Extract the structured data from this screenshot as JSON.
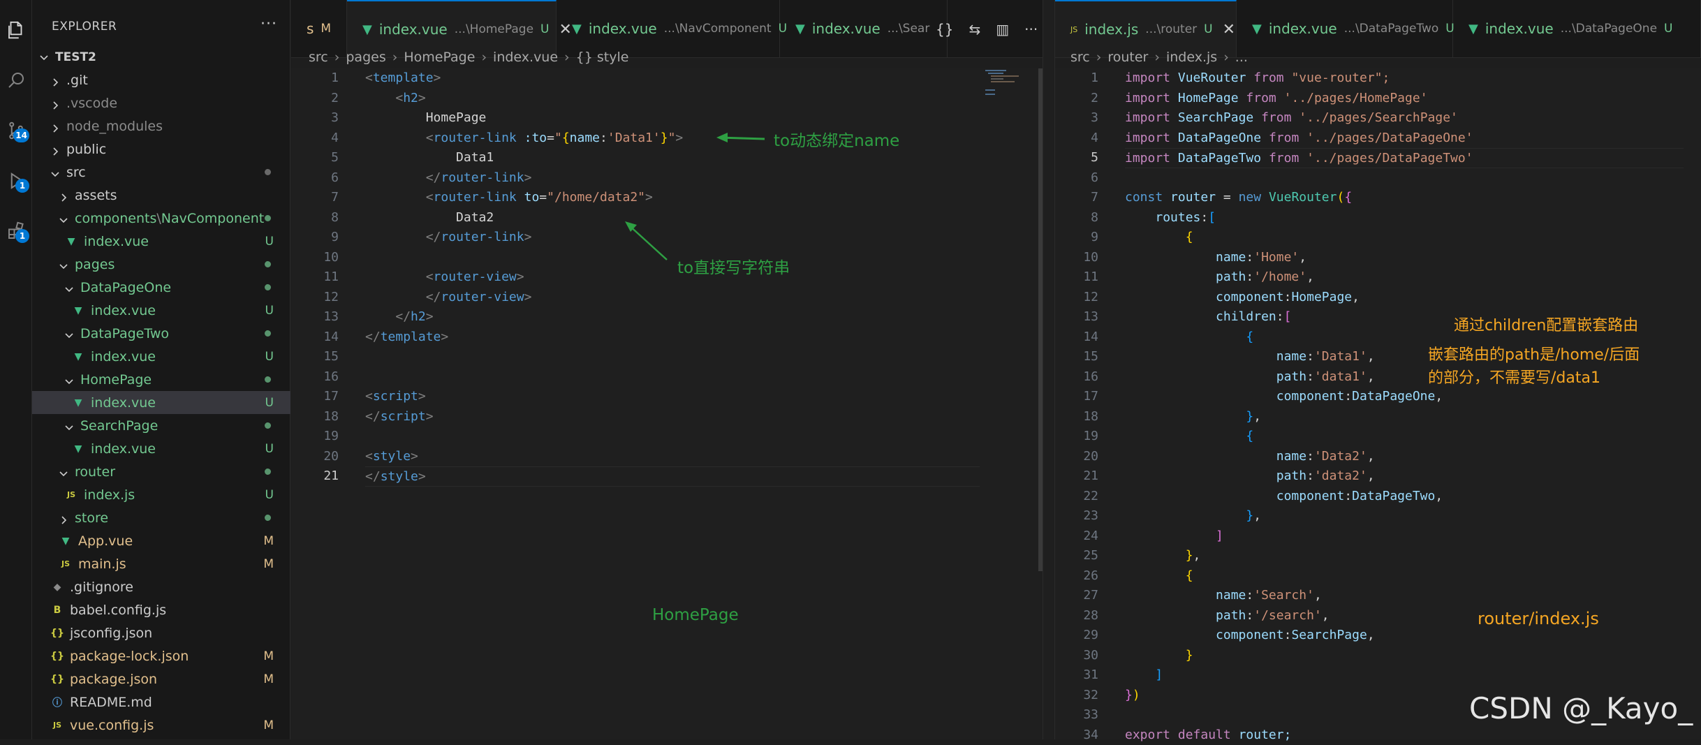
{
  "sidebar": {
    "title": "EXPLORER",
    "more": "···",
    "workspace": "TEST2",
    "items": [
      {
        "label": ".git",
        "type": "folder",
        "indent": 1,
        "expanded": false
      },
      {
        "label": ".vscode",
        "type": "folder",
        "indent": 1,
        "expanded": false,
        "dim": true
      },
      {
        "label": "node_modules",
        "type": "folder",
        "indent": 1,
        "expanded": false,
        "dim": true
      },
      {
        "label": "public",
        "type": "folder",
        "indent": 1,
        "expanded": false
      },
      {
        "label": "src",
        "type": "folder",
        "indent": 1,
        "expanded": true,
        "dot": "#8b8b8b"
      },
      {
        "label": "assets",
        "type": "folder",
        "indent": 2,
        "expanded": false
      },
      {
        "label": "components",
        "label2": "NavComponent",
        "type": "folder",
        "indent": 2,
        "expanded": true,
        "dot": "#73c991",
        "color": "green"
      },
      {
        "label": "index.vue",
        "type": "vue",
        "indent": 3,
        "status": "U",
        "color": "green"
      },
      {
        "label": "pages",
        "type": "folder",
        "indent": 2,
        "expanded": true,
        "dot": "#73c991",
        "color": "green"
      },
      {
        "label": "DataPageOne",
        "type": "folder",
        "indent": 3,
        "expanded": true,
        "dot": "#73c991",
        "color": "green"
      },
      {
        "label": "index.vue",
        "type": "vue",
        "indent": 4,
        "status": "U",
        "color": "green"
      },
      {
        "label": "DataPageTwo",
        "type": "folder",
        "indent": 3,
        "expanded": true,
        "dot": "#73c991",
        "color": "green"
      },
      {
        "label": "index.vue",
        "type": "vue",
        "indent": 4,
        "status": "U",
        "color": "green"
      },
      {
        "label": "HomePage",
        "type": "folder",
        "indent": 3,
        "expanded": true,
        "dot": "#73c991",
        "color": "green"
      },
      {
        "label": "index.vue",
        "type": "vue",
        "indent": 4,
        "status": "U",
        "color": "green",
        "selected": true
      },
      {
        "label": "SearchPage",
        "type": "folder",
        "indent": 3,
        "expanded": true,
        "dot": "#73c991",
        "color": "green"
      },
      {
        "label": "index.vue",
        "type": "vue",
        "indent": 4,
        "status": "U",
        "color": "green"
      },
      {
        "label": "router",
        "type": "folder",
        "indent": 2,
        "expanded": true,
        "dot": "#73c991",
        "color": "green"
      },
      {
        "label": "index.js",
        "type": "js",
        "indent": 3,
        "status": "U",
        "color": "green"
      },
      {
        "label": "store",
        "type": "folder",
        "indent": 2,
        "expanded": false,
        "dot": "#73c991",
        "color": "green"
      },
      {
        "label": "App.vue",
        "type": "vue",
        "indent": 2,
        "status": "M",
        "color": "yellow"
      },
      {
        "label": "main.js",
        "type": "js",
        "indent": 2,
        "status": "M",
        "color": "yellow"
      },
      {
        "label": ".gitignore",
        "type": "git",
        "indent": 1
      },
      {
        "label": "babel.config.js",
        "type": "babel",
        "indent": 1
      },
      {
        "label": "jsconfig.json",
        "type": "json",
        "indent": 1
      },
      {
        "label": "package-lock.json",
        "type": "json",
        "indent": 1,
        "status": "M",
        "color": "yellow"
      },
      {
        "label": "package.json",
        "type": "json",
        "indent": 1,
        "status": "M",
        "color": "yellow"
      },
      {
        "label": "README.md",
        "type": "info",
        "indent": 1
      },
      {
        "label": "vue.config.js",
        "type": "js",
        "indent": 1,
        "status": "M",
        "color": "yellow"
      }
    ]
  },
  "activity": {
    "scm_badge": "14",
    "run_badge": "1",
    "ext_badge": "1"
  },
  "left_editor": {
    "tabs": [
      {
        "label": "s",
        "desc": "",
        "status": "M",
        "partial": true
      },
      {
        "label": "index.vue",
        "desc": "...\\HomePage",
        "status": "U",
        "active": true,
        "close": "✕"
      },
      {
        "label": "index.vue",
        "desc": "...\\NavComponent",
        "status": "U"
      },
      {
        "label": "index.vue",
        "desc": "...\\Sear",
        "status": ""
      }
    ],
    "actions": [
      "{}",
      "⇆",
      "▥",
      "···"
    ],
    "breadcrumb": [
      "src",
      "pages",
      "HomePage",
      "index.vue",
      "{} style"
    ],
    "lines": [
      "1",
      "2",
      "3",
      "4",
      "5",
      "6",
      "7",
      "8",
      "9",
      "10",
      "11",
      "12",
      "13",
      "14",
      "15",
      "16",
      "17",
      "18",
      "19",
      "20",
      "21"
    ],
    "current_line": "21",
    "code": {
      "l1": "template",
      "l2": "h2",
      "l3": "HomePage",
      "l4_tag": "router-link",
      "l4_attr": ":to",
      "l4_str1": "\"",
      "l4_key": "name",
      "l4_val": "'Data1'",
      "l5": "Data1",
      "l6": "router-link",
      "l7_tag": "router-link",
      "l7_attr": "to",
      "l7_val": "\"/home/data2\"",
      "l8": "Data2",
      "l9": "router-link",
      "l11": "router-view",
      "l12": "router-view",
      "l13": "h2",
      "l14": "template",
      "l17": "script",
      "l18": "script",
      "l20": "style",
      "l21": "style"
    },
    "annotations": {
      "a1": "to动态绑定name",
      "a2": "to直接写字符串",
      "a3": "HomePage"
    }
  },
  "right_editor": {
    "tabs": [
      {
        "label": "index.js",
        "desc": "...\\router",
        "status": "U",
        "active": true,
        "close": "✕"
      },
      {
        "label": "index.vue",
        "desc": "...\\DataPageTwo",
        "status": "U"
      },
      {
        "label": "index.vue",
        "desc": "...\\DataPageOne",
        "status": "U"
      }
    ],
    "breadcrumb": [
      "src",
      "router",
      "index.js",
      "..."
    ],
    "lines": [
      "1",
      "2",
      "3",
      "4",
      "5",
      "6",
      "7",
      "8",
      "9",
      "10",
      "11",
      "12",
      "13",
      "14",
      "15",
      "16",
      "17",
      "18",
      "19",
      "20",
      "21",
      "22",
      "23",
      "24",
      "25",
      "26",
      "27",
      "28",
      "29",
      "30",
      "31",
      "32",
      "33",
      "34"
    ],
    "current_line": "5",
    "code": {
      "import": "import",
      "from": "from",
      "imports": [
        {
          "name": "VueRouter",
          "path": "\"vue-router\";"
        },
        {
          "name": "HomePage",
          "path": "'../pages/HomePage'"
        },
        {
          "name": "SearchPage",
          "path": "'../pages/SearchPage'"
        },
        {
          "name": "DataPageOne",
          "path": "'../pages/DataPageOne'"
        },
        {
          "name": "DataPageTwo",
          "path": "'../pages/DataPageTwo'"
        }
      ],
      "const": "const",
      "router": "router",
      "new": "new",
      "VueRouter": "VueRouter",
      "routes": "routes",
      "name": "name",
      "path": "path",
      "component": "component",
      "children": "children",
      "home_name": "'Home'",
      "home_path": "'/home'",
      "home_comp": "HomePage",
      "d1_name": "'Data1'",
      "d1_path": "'data1'",
      "d1_comp": "DataPageOne",
      "d2_name": "'Data2'",
      "d2_path": "'data2'",
      "d2_comp": "DataPageTwo",
      "s_name": "'Search'",
      "s_path": "'/search'",
      "s_comp": "SearchPage",
      "export": "export",
      "default": "default",
      "exp_router": "router;"
    },
    "annotations": {
      "a1": "通过children配置嵌套路由",
      "a2a": "嵌套路由的path是/home/后面",
      "a2b": "的部分，不需要写/data1",
      "a3": "router/index.js"
    }
  },
  "watermark": "CSDN @_Kayo_"
}
